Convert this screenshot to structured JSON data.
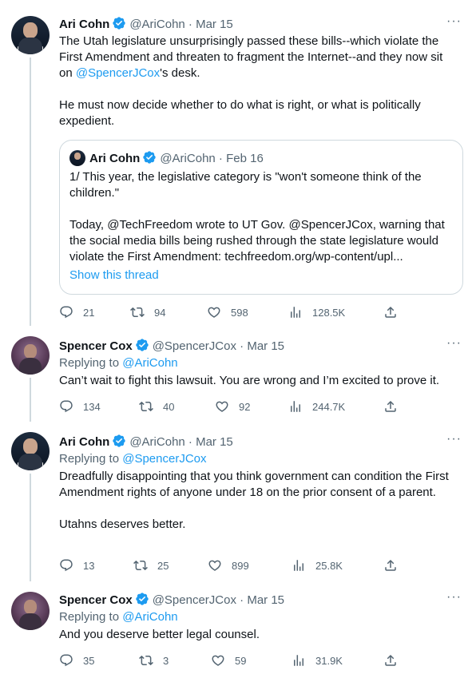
{
  "tweets": [
    {
      "name": "Ari Cohn",
      "handle": "@AriCohn",
      "date": "· Mar 15",
      "body_1_pre": "The Utah legislature unsurprisingly passed these bills--which violate the First Amendment and threaten to fragment the Internet--and they now sit on ",
      "body_1_link": "@SpencerJCox",
      "body_1_post": "'s desk.",
      "body_2": "He must now decide whether to do what is right, or what is politically expedient.",
      "quote": {
        "name": "Ari Cohn",
        "handle": "@AriCohn",
        "date": "· Feb 16",
        "p1": "1/ This year, the legislative category is \"won't someone think of the children.\"",
        "p2": "Today, @TechFreedom wrote to UT Gov. @SpencerJCox, warning that the social media bills being rushed through the state legislature would violate the First Amendment: techfreedom.org/wp-content/upl...",
        "show_thread": "Show this thread"
      },
      "replies": "21",
      "retweets": "94",
      "likes": "598",
      "views": "128.5K"
    },
    {
      "name": "Spencer Cox",
      "handle": "@SpencerJCox",
      "date": "· Mar 15",
      "replying_prefix": "Replying to",
      "replying_to": "@AriCohn",
      "body": "Can’t wait to fight this lawsuit. You are wrong and I’m excited to prove it.",
      "replies": "134",
      "retweets": "40",
      "likes": "92",
      "views": "244.7K"
    },
    {
      "name": "Ari Cohn",
      "handle": "@AriCohn",
      "date": "· Mar 15",
      "replying_prefix": "Replying to",
      "replying_to": "@SpencerJCox",
      "body_1": "Dreadfully disappointing that you think government can condition the First Amendment rights of anyone under 18 on the prior consent of a parent.",
      "body_2": "Utahns deserves better.",
      "replies": "13",
      "retweets": "25",
      "likes": "899",
      "views": "25.8K"
    },
    {
      "name": "Spencer Cox",
      "handle": "@SpencerJCox",
      "date": "· Mar 15",
      "replying_prefix": "Replying to",
      "replying_to": "@AriCohn",
      "body": "And you deserve better legal counsel.",
      "replies": "35",
      "retweets": "3",
      "likes": "59",
      "views": "31.9K"
    }
  ],
  "icons": {
    "more": "more-icon",
    "verified": "verified-badge-icon",
    "reply": "reply-icon",
    "retweet": "retweet-icon",
    "like": "like-icon",
    "views": "views-icon",
    "share": "share-icon"
  },
  "colors": {
    "accent": "#1d9bf0",
    "text": "#0f1419",
    "secondary": "#536471",
    "border": "#cfd9de"
  }
}
